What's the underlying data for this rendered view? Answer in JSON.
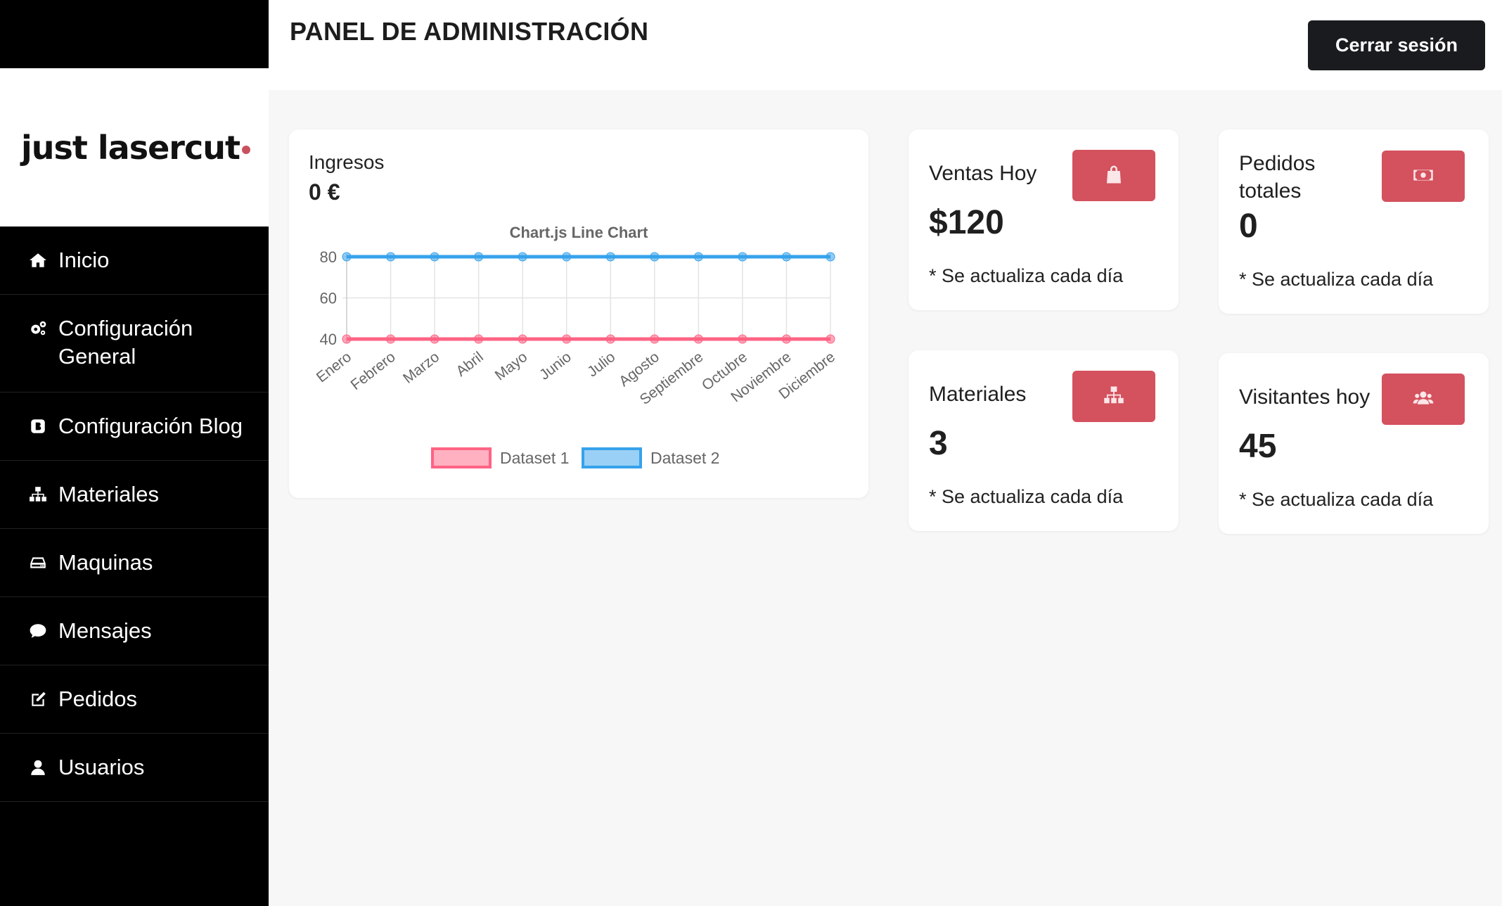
{
  "brand": {
    "logo_text": "just lasercut",
    "accent": "#c9515e"
  },
  "sidebar": {
    "items": [
      {
        "label": "Inicio",
        "icon": "home-icon"
      },
      {
        "label": "Configuración General",
        "icon": "gears-icon"
      },
      {
        "label": "Configuración Blog",
        "icon": "blog-icon"
      },
      {
        "label": "Materiales",
        "icon": "sitemap-icon"
      },
      {
        "label": "Maquinas",
        "icon": "hdd-icon"
      },
      {
        "label": "Mensajes",
        "icon": "comment-icon"
      },
      {
        "label": "Pedidos",
        "icon": "edit-icon"
      },
      {
        "label": "Usuarios",
        "icon": "user-icon"
      }
    ]
  },
  "header": {
    "title": "PANEL DE ADMINISTRACIÓN",
    "logout_label": "Cerrar sesión"
  },
  "income": {
    "label": "Ingresos",
    "value": "0 €"
  },
  "chart_data": {
    "type": "line",
    "title": "Chart.js Line Chart",
    "categories": [
      "Enero",
      "Febrero",
      "Marzo",
      "Abril",
      "Mayo",
      "Junio",
      "Julio",
      "Agosto",
      "Septiembre",
      "Octubre",
      "Noviembre",
      "Diciembre"
    ],
    "series": [
      {
        "name": "Dataset 1",
        "values": [
          40,
          40,
          40,
          40,
          40,
          40,
          40,
          40,
          40,
          40,
          40,
          40
        ],
        "color": "#ff6384"
      },
      {
        "name": "Dataset 2",
        "values": [
          80,
          80,
          80,
          80,
          80,
          80,
          80,
          80,
          80,
          80,
          80,
          80
        ],
        "color": "#36a2eb"
      }
    ],
    "yticks": [
      40,
      60,
      80
    ],
    "ylim": [
      40,
      80
    ],
    "grid": true,
    "legend": "bottom"
  },
  "stats": {
    "ventas": {
      "title": "Ventas Hoy",
      "value": "$120",
      "note": "* Se actualiza cada día",
      "icon": "shopping-bag-icon"
    },
    "pedidos": {
      "title": "Pedidos totales",
      "value": "0",
      "note": "* Se actualiza cada día",
      "icon": "money-bill-icon"
    },
    "materiales": {
      "title": "Materiales",
      "value": "3",
      "note": "* Se actualiza cada día",
      "icon": "sitemap-icon"
    },
    "visitantes": {
      "title": "Visitantes hoy",
      "value": "45",
      "note": "* Se actualiza cada día",
      "icon": "users-icon"
    }
  },
  "colors": {
    "stat_button": "#d4515e",
    "logout_button": "#191b1e",
    "sidebar": "#000000"
  }
}
